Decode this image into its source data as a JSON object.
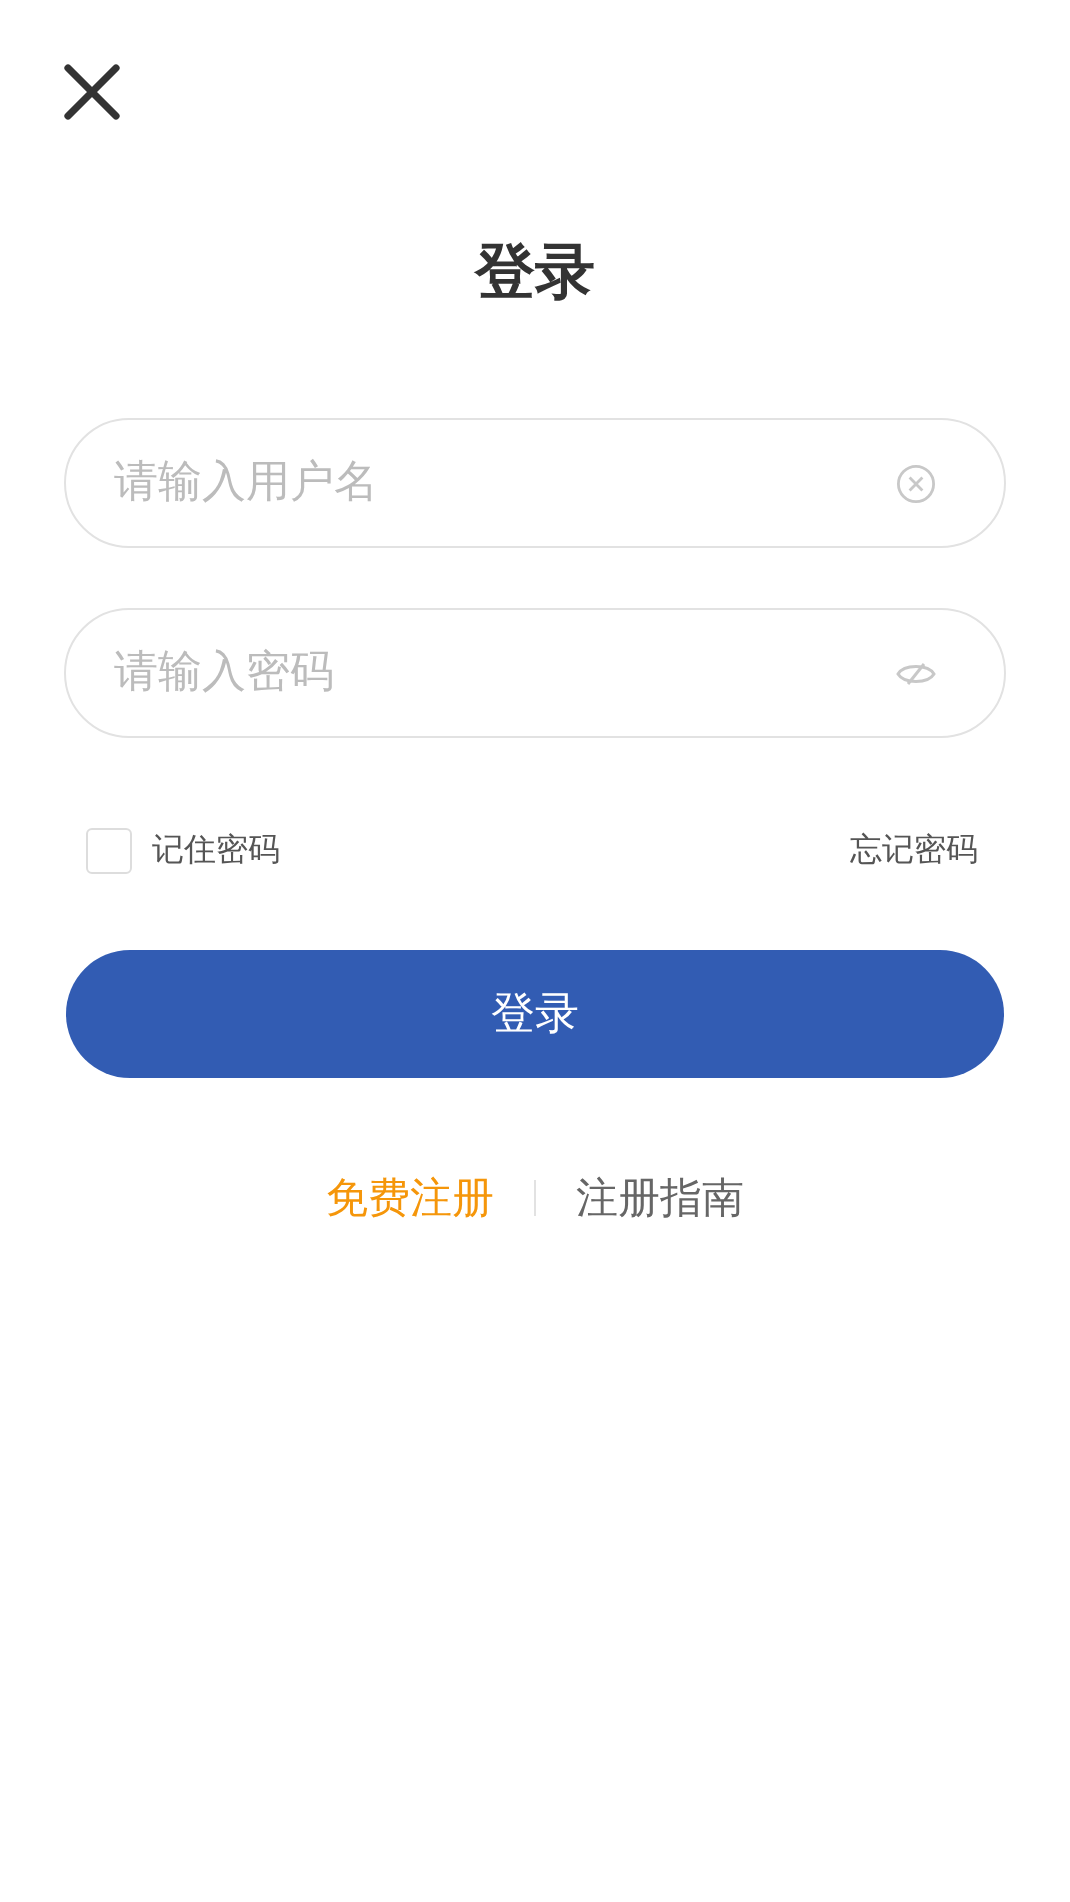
{
  "title": "登录",
  "fields": [
    {
      "kind": "username",
      "placeholder": "请输入用户名"
    },
    {
      "kind": "password",
      "placeholder": "请输入密码"
    }
  ],
  "remember": {
    "label": "记住密码",
    "checked": false
  },
  "forgot": "忘记密码",
  "submit": "登录",
  "links": [
    {
      "kind": "primary",
      "label": "免费注册"
    },
    {
      "kind": "secondary",
      "label": "注册指南"
    }
  ]
}
